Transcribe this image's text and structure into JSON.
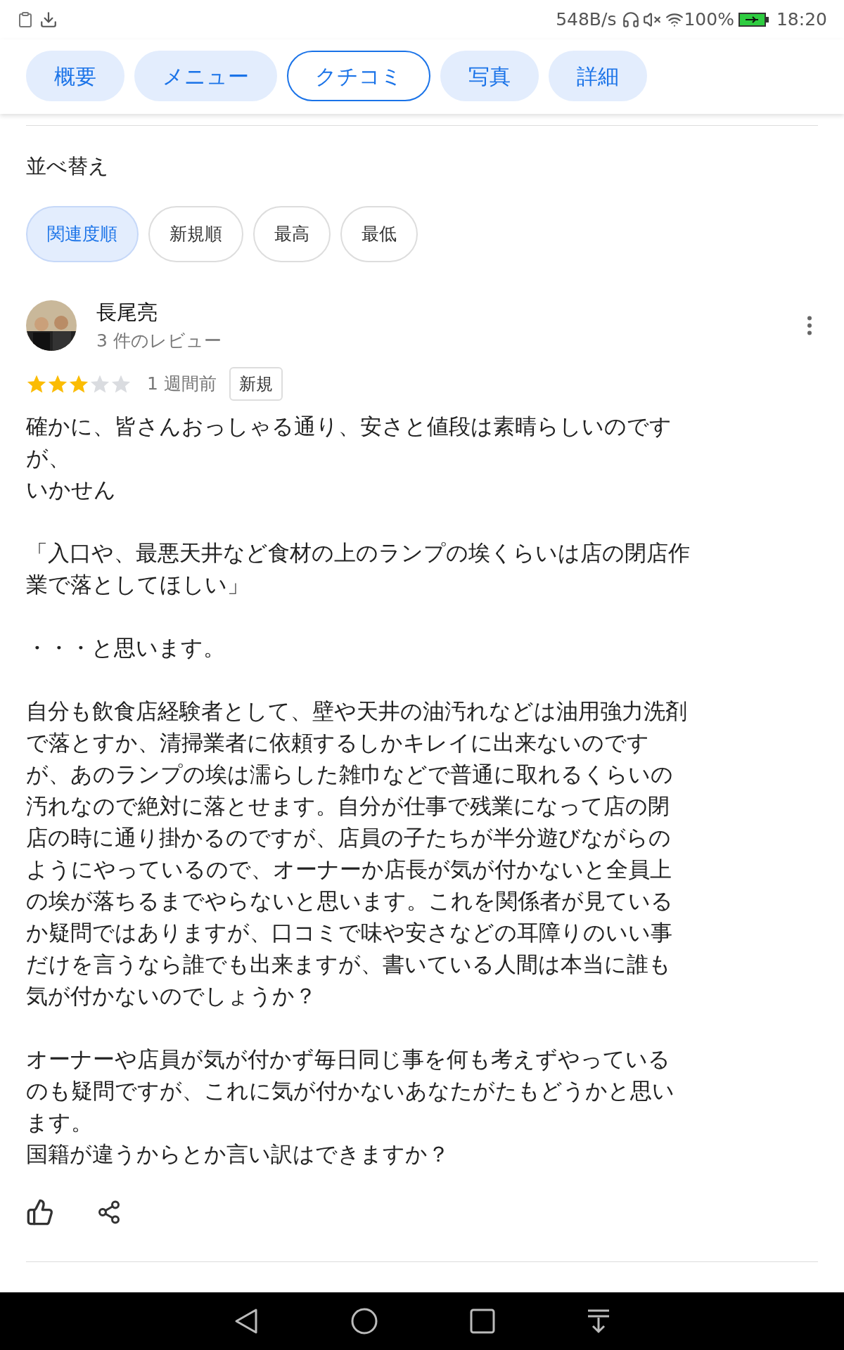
{
  "status_bar": {
    "speed": "548B/s",
    "battery": "100%",
    "time": "18:20"
  },
  "tabs": [
    {
      "label": "概要",
      "selected": false
    },
    {
      "label": "メニュー",
      "selected": false
    },
    {
      "label": "クチコミ",
      "selected": true
    },
    {
      "label": "写真",
      "selected": false
    },
    {
      "label": "詳細",
      "selected": false
    }
  ],
  "sort": {
    "title": "並べ替え",
    "options": [
      {
        "label": "関連度順",
        "selected": true
      },
      {
        "label": "新規順",
        "selected": false
      },
      {
        "label": "最高",
        "selected": false
      },
      {
        "label": "最低",
        "selected": false
      }
    ]
  },
  "review": {
    "author": "長尾亮",
    "review_count": "3 件のレビュー",
    "stars": 3,
    "time": "1 週間前",
    "badge": "新規",
    "paragraphs": [
      [
        "確かに、皆さんおっしゃる通り、安さと値段は素晴らしいのですが、",
        "いかせん"
      ],
      [
        "「入口や、最悪天井など食材の上のランプの埃くらいは店の閉店作業で落としてほしい」"
      ],
      [
        "・・・と思います。"
      ],
      [
        "自分も飲食店経験者として、壁や天井の油汚れなどは油用強力洗剤で落とすか、清掃業者に依頼するしかキレイに出来ないのですが、あのランプの埃は濡らした雑巾などで普通に取れるくらいの汚れなので絶対に落とせます。自分が仕事で残業になって店の閉店の時に通り掛かるのですが、店員の子たちが半分遊びながらのようにやっているので、オーナーか店長が気が付かないと全員上の埃が落ちるまでやらないと思います。これを関係者が見ているか疑問ではありますが、口コミで味や安さなどの耳障りのいい事だけを言うなら誰でも出来ますが、書いている人間は本当に誰も気が付かないのでしょうか？"
      ],
      [
        "オーナーや店員が気が付かず毎日同じ事を何も考えずやっているのも疑問ですが、これに気が付かないあなたがたもどうかと思います。",
        "国籍が違うからとか言い訳はできますか？"
      ]
    ]
  }
}
